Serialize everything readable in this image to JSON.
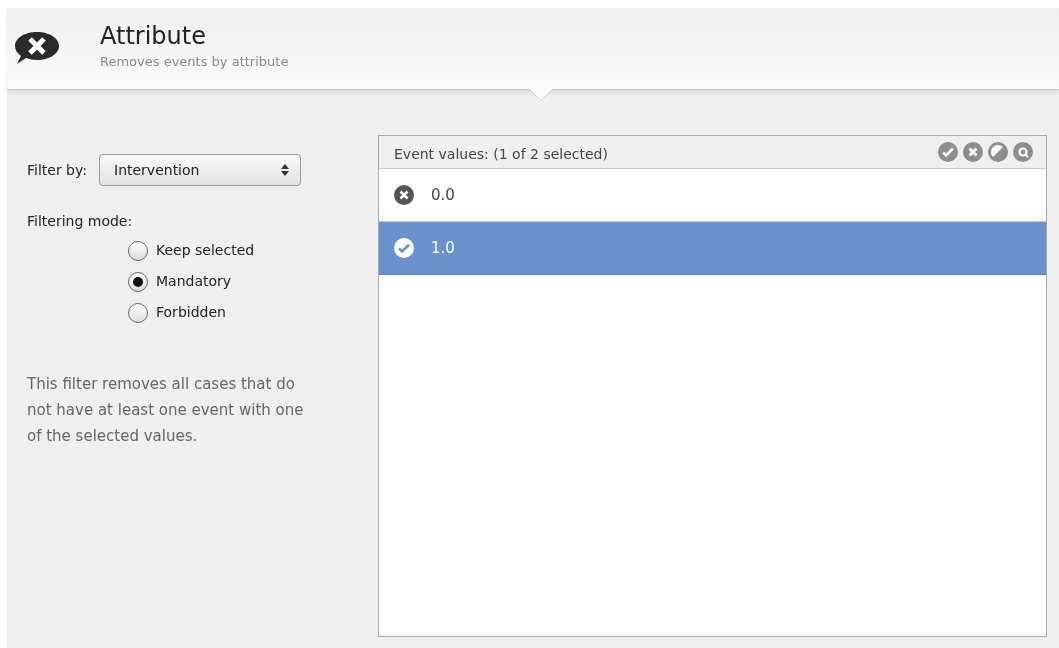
{
  "header": {
    "title": "Attribute",
    "subtitle": "Removes events by attribute"
  },
  "filter_by": {
    "label": "Filter by:",
    "value": "Intervention"
  },
  "filtering_mode": {
    "label": "Filtering mode:",
    "options": [
      {
        "label": "Keep selected",
        "selected": false
      },
      {
        "label": "Mandatory",
        "selected": true
      },
      {
        "label": "Forbidden",
        "selected": false
      }
    ]
  },
  "description": "This filter removes all cases that do not have at least one event with one of the selected values.",
  "event_values": {
    "title": "Event values:  (1 of 2 selected)",
    "toolbar": [
      {
        "kind": "check"
      },
      {
        "kind": "cross"
      },
      {
        "kind": "invert"
      },
      {
        "kind": "search"
      }
    ],
    "rows": [
      {
        "label": "0.0",
        "selected": false
      },
      {
        "label": "1.0",
        "selected": true
      }
    ]
  }
}
